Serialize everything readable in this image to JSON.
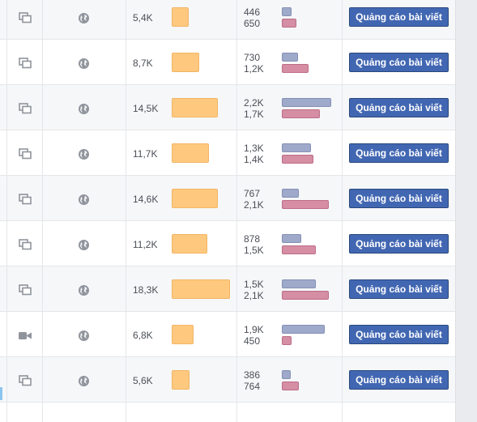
{
  "boost_label": "Quảng cáo bài viết",
  "colors": {
    "reach_bar": "#fec97e",
    "engagement_bar_1": "#9fa9c9",
    "engagement_bar_2": "#d58ea4",
    "button": "#4267b2"
  },
  "rows": [
    {
      "type_icon": "multi-photo-icon",
      "privacy_icon": "globe-icon",
      "reach": "5,4K",
      "reach_value": 5400,
      "eng1": "446",
      "eng1_value": 446,
      "eng2": "650",
      "eng2_value": 650
    },
    {
      "type_icon": "multi-photo-icon",
      "privacy_icon": "globe-icon",
      "reach": "8,7K",
      "reach_value": 8700,
      "eng1": "730",
      "eng1_value": 730,
      "eng2": "1,2K",
      "eng2_value": 1200
    },
    {
      "type_icon": "multi-photo-icon",
      "privacy_icon": "globe-icon",
      "reach": "14,5K",
      "reach_value": 14500,
      "eng1": "2,2K",
      "eng1_value": 2200,
      "eng2": "1,7K",
      "eng2_value": 1700
    },
    {
      "type_icon": "multi-photo-icon",
      "privacy_icon": "globe-icon",
      "reach": "11,7K",
      "reach_value": 11700,
      "eng1": "1,3K",
      "eng1_value": 1300,
      "eng2": "1,4K",
      "eng2_value": 1400
    },
    {
      "type_icon": "multi-photo-icon",
      "privacy_icon": "globe-icon",
      "reach": "14,6K",
      "reach_value": 14600,
      "eng1": "767",
      "eng1_value": 767,
      "eng2": "2,1K",
      "eng2_value": 2100
    },
    {
      "type_icon": "multi-photo-icon",
      "privacy_icon": "globe-icon",
      "reach": "11,2K",
      "reach_value": 11200,
      "eng1": "878",
      "eng1_value": 878,
      "eng2": "1,5K",
      "eng2_value": 1500
    },
    {
      "type_icon": "multi-photo-icon",
      "privacy_icon": "globe-icon",
      "reach": "18,3K",
      "reach_value": 18300,
      "eng1": "1,5K",
      "eng1_value": 1500,
      "eng2": "2,1K",
      "eng2_value": 2100
    },
    {
      "type_icon": "video-camera-icon",
      "privacy_icon": "globe-icon",
      "reach": "6,8K",
      "reach_value": 6800,
      "eng1": "1,9K",
      "eng1_value": 1900,
      "eng2": "450",
      "eng2_value": 450
    },
    {
      "type_icon": "multi-photo-icon",
      "privacy_icon": "globe-icon",
      "reach": "5,6K",
      "reach_value": 5600,
      "eng1": "386",
      "eng1_value": 386,
      "eng2": "764",
      "eng2_value": 764
    }
  ]
}
